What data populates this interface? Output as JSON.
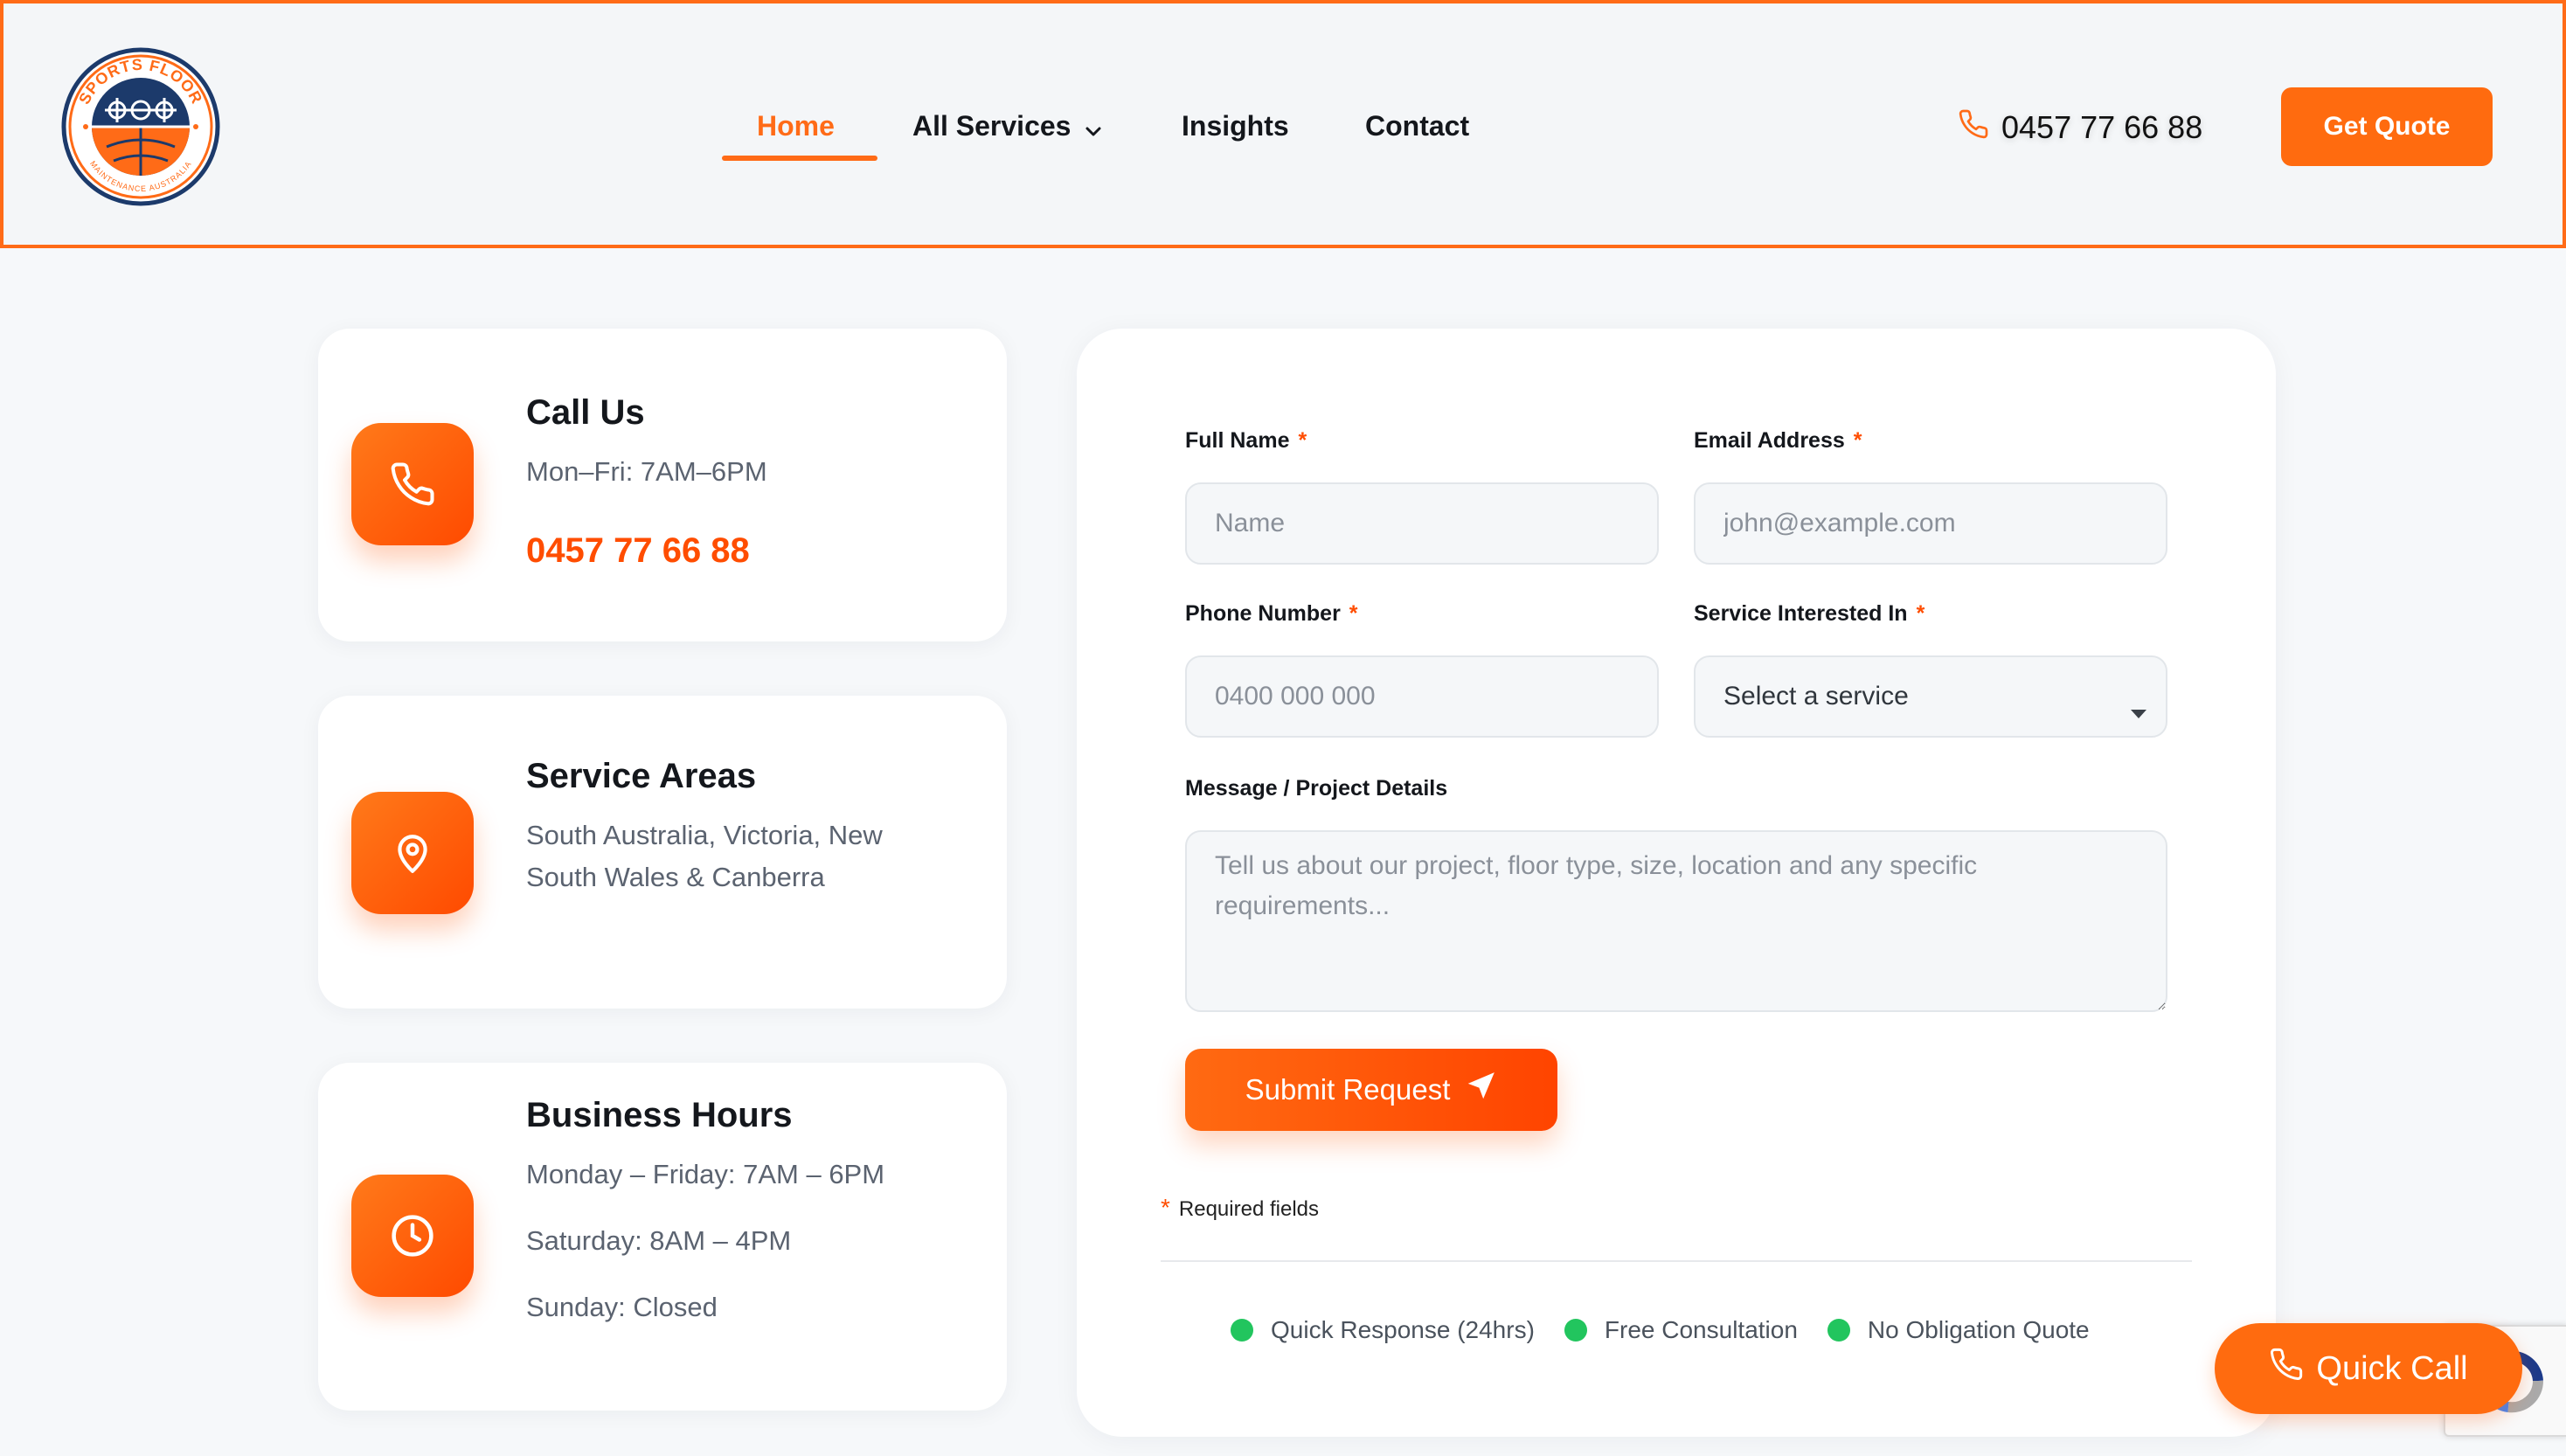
{
  "brand": {
    "logo_ring_text_top": "SPORTS FLOOR",
    "logo_ring_text_bottom": "MAINTENANCE AUSTRALIA",
    "colors": {
      "accent": "#ff6b17",
      "navy": "#1c3a6b",
      "success": "#22c55e"
    }
  },
  "nav": {
    "items": [
      {
        "label": "Home",
        "active": true
      },
      {
        "label": "All Services",
        "has_dropdown": true
      },
      {
        "label": "Insights"
      },
      {
        "label": "Contact"
      }
    ],
    "phone": "0457 77 66 88",
    "cta": "Get Quote"
  },
  "cards": {
    "call": {
      "icon": "phone-icon",
      "title": "Call Us",
      "hours": "Mon–Fri: 7AM–6PM",
      "phone": "0457 77 66 88"
    },
    "areas": {
      "icon": "map-pin-icon",
      "title": "Service Areas",
      "line1": "South Australia, Victoria, New",
      "line2": "South Wales & Canberra"
    },
    "hours": {
      "icon": "clock-icon",
      "title": "Business Hours",
      "weekdays": "Monday – Friday: 7AM – 6PM",
      "saturday": "Saturday: 8AM – 4PM",
      "sunday": "Sunday: Closed"
    }
  },
  "form": {
    "full_name": {
      "label": "Full Name",
      "placeholder": "Name",
      "required_mark": "*"
    },
    "email": {
      "label": "Email Address",
      "placeholder": "john@example.com",
      "required_mark": "*"
    },
    "phone": {
      "label": "Phone Number",
      "placeholder": "0400 000 000",
      "required_mark": "*"
    },
    "service": {
      "label": "Service Interested In",
      "selected": "Select a service",
      "required_mark": "*"
    },
    "message": {
      "label": "Message / Project Details",
      "placeholder": "Tell us about our project, floor type, size, location and any specific requirements..."
    },
    "submit": "Submit Request",
    "required_note": "Required fields",
    "required_star": "*",
    "badges": [
      "Quick Response (24hrs)",
      "Free Consultation",
      "No Obligation Quote"
    ]
  },
  "floating": {
    "quick_call": "Quick Call"
  }
}
